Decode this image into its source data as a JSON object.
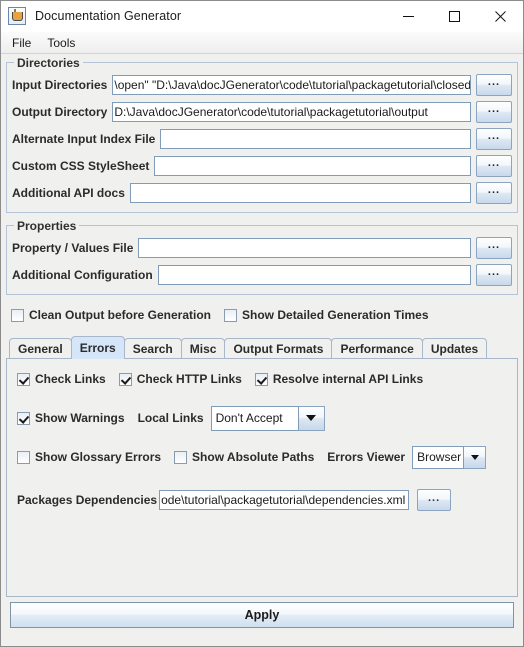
{
  "window": {
    "title": "Documentation Generator",
    "icon": "java-cup-icon",
    "controls": {
      "minimize": "minimize-icon",
      "maximize": "maximize-icon",
      "close": "close-icon"
    }
  },
  "menubar": {
    "items": [
      {
        "label": "File"
      },
      {
        "label": "Tools"
      }
    ]
  },
  "directories": {
    "title": "Directories",
    "browse_label": "...",
    "rows": [
      {
        "label": "Input Directories",
        "value": "\\open\" \"D:\\Java\\docJGenerator\\code\\tutorial\\packagetutorial\\closed\"",
        "placeholder": ""
      },
      {
        "label": "Output Directory",
        "value": "D:\\Java\\docJGenerator\\code\\tutorial\\packagetutorial\\output",
        "placeholder": ""
      },
      {
        "label": "Alternate Input Index File",
        "value": "",
        "placeholder": ""
      },
      {
        "label": "Custom CSS StyleSheet",
        "value": "",
        "placeholder": ""
      },
      {
        "label": "Additional API docs",
        "value": "",
        "placeholder": ""
      }
    ]
  },
  "properties": {
    "title": "Properties",
    "browse_label": "...",
    "rows": [
      {
        "label": "Property / Values File",
        "value": "",
        "placeholder": ""
      },
      {
        "label": "Additional Configuration",
        "value": "",
        "placeholder": ""
      }
    ],
    "checkboxes": [
      {
        "label": "Clean Output before Generation",
        "checked": false
      },
      {
        "label": "Show Detailed Generation Times",
        "checked": false
      }
    ]
  },
  "tabs": {
    "selected": "Errors",
    "items": [
      {
        "label": "General",
        "selected": false
      },
      {
        "label": "Errors",
        "selected": true
      },
      {
        "label": "Search",
        "selected": false
      },
      {
        "label": "Misc",
        "selected": false
      },
      {
        "label": "Output Formats",
        "selected": false
      },
      {
        "label": "Performance",
        "selected": false
      },
      {
        "label": "Updates",
        "selected": false
      }
    ]
  },
  "errors_panel": {
    "row1": [
      {
        "label": "Check Links",
        "checked": true
      },
      {
        "label": "Check HTTP Links",
        "checked": true
      },
      {
        "label": "Resolve internal API Links",
        "checked": true
      }
    ],
    "row2": {
      "show_warnings": {
        "label": "Show Warnings",
        "checked": true
      },
      "local_links_label": "Local Links",
      "local_links_value": "Don't Accept"
    },
    "row3": {
      "show_glossary_errors": {
        "label": "Show Glossary Errors",
        "checked": false
      },
      "show_absolute_paths": {
        "label": "Show Absolute Paths",
        "checked": false
      },
      "errors_viewer_label": "Errors Viewer",
      "errors_viewer_value": "Browser"
    },
    "row4": {
      "label": "Packages Dependencies",
      "value": "ode\\tutorial\\packagetutorial\\dependencies.xml",
      "browse_label": "..."
    }
  },
  "footer": {
    "apply_label": "Apply"
  },
  "colors": {
    "window_bg": "#f0f0ef",
    "tab_selected": "#d4e6f7",
    "field_border": "#7f9db9",
    "group_border": "#b5c4d6"
  }
}
